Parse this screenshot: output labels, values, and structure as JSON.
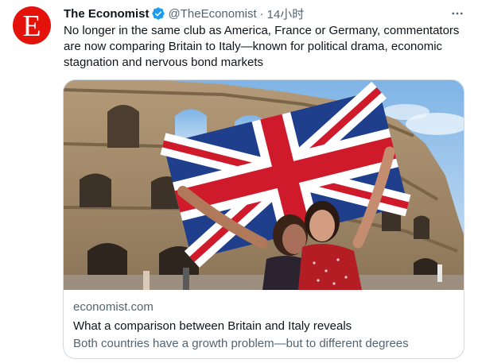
{
  "tweet": {
    "author": {
      "display_name": "The Economist",
      "handle": "@TheEconomist",
      "avatar_letter": "E",
      "verified": true,
      "brand_color": "#e3120b"
    },
    "separator": "·",
    "time": "14小时",
    "more_icon": "more-horizontal-icon",
    "text": "No longer in the same club as America, France or Germany, commentators are now comparing Britain to Italy—known for political drama, economic stagnation and nervous bond markets"
  },
  "card": {
    "domain": "economist.com",
    "title": "What a comparison between Britain and Italy reveals",
    "description": "Both countries have a growth problem—but to different degrees"
  },
  "colors": {
    "text_primary": "#0f1419",
    "text_secondary": "#536471",
    "border": "#cfd9de",
    "verified_blue": "#1d9bf0"
  }
}
